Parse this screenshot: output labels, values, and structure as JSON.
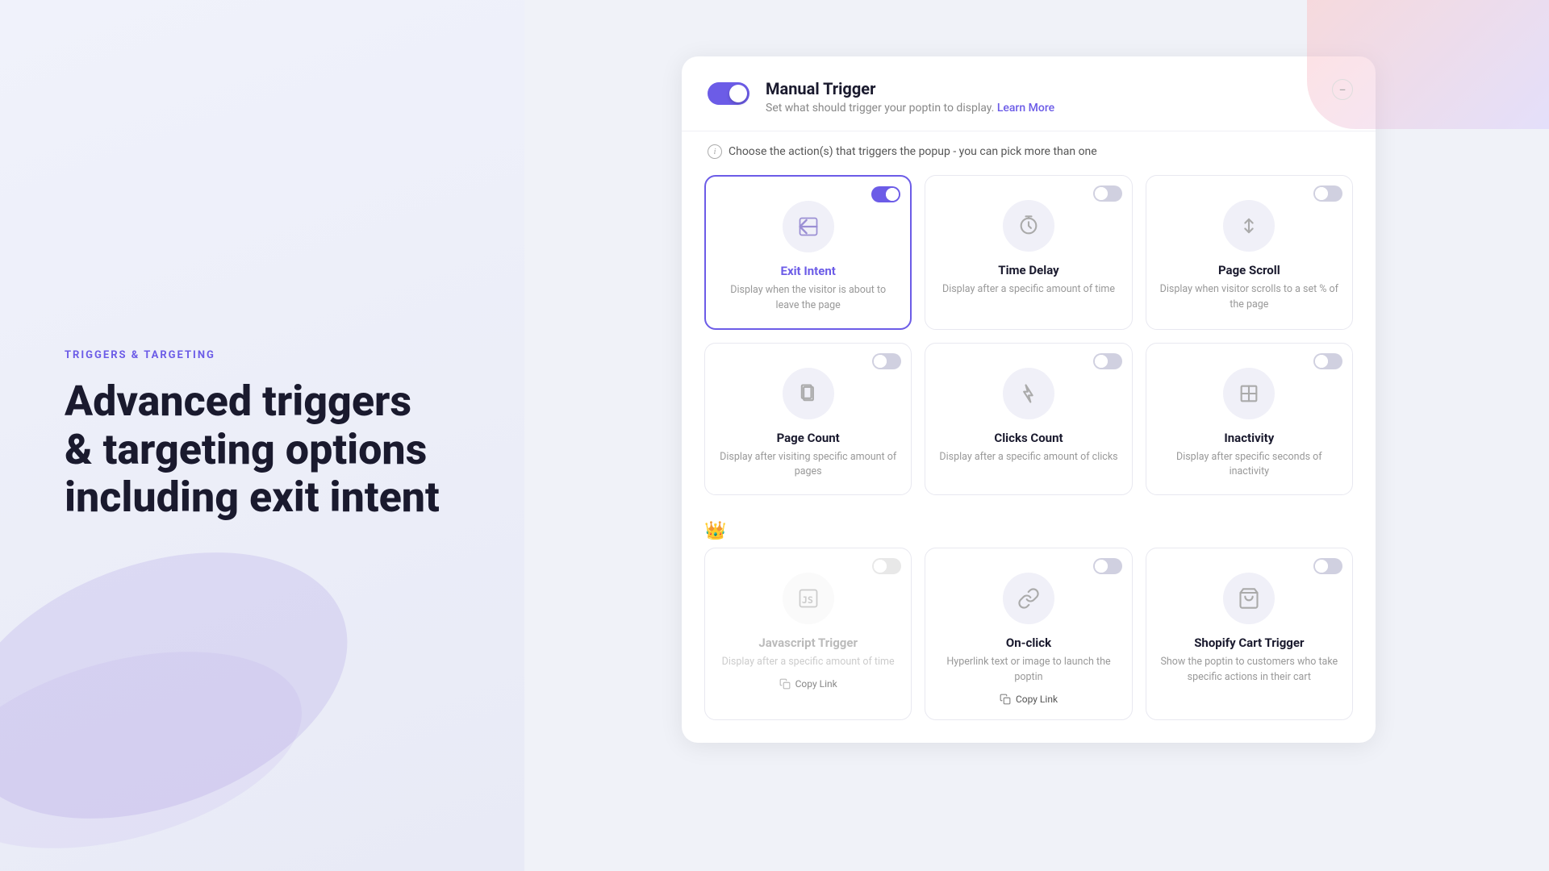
{
  "left": {
    "section_label": "TRIGGERS & TARGETING",
    "heading_line1": "Advanced triggers",
    "heading_line2": "& targeting options",
    "heading_line3": "including exit intent"
  },
  "right": {
    "header": {
      "title": "Manual Trigger",
      "subtitle": "Set what should trigger your poptin to display.",
      "learn_more": "Learn More",
      "toggle_active": true
    },
    "choose_action_text": "Choose the action(s) that triggers the popup - you can pick more than one",
    "triggers": [
      {
        "id": "exit-intent",
        "title": "Exit Intent",
        "description": "Display when the visitor is about to leave the page",
        "active": true,
        "icon": "exit"
      },
      {
        "id": "time-delay",
        "title": "Time Delay",
        "description": "Display after a specific amount of time",
        "active": false,
        "icon": "clock"
      },
      {
        "id": "page-scroll",
        "title": "Page Scroll",
        "description": "Display when visitor scrolls to a set % of the page",
        "active": false,
        "icon": "scroll"
      },
      {
        "id": "page-count",
        "title": "Page Count",
        "description": "Display after visiting specific amount of pages",
        "active": false,
        "icon": "pages"
      },
      {
        "id": "clicks-count",
        "title": "Clicks Count",
        "description": "Display after a specific amount of clicks",
        "active": false,
        "icon": "clicks"
      },
      {
        "id": "inactivity",
        "title": "Inactivity",
        "description": "Display after specific seconds of inactivity",
        "active": false,
        "icon": "timer"
      }
    ],
    "bottom_triggers": [
      {
        "id": "javascript-trigger",
        "title": "Javascript Trigger",
        "description": "Display after a specific amount of time",
        "active": false,
        "disabled": true,
        "icon": "js",
        "copy_link": "Copy Link"
      },
      {
        "id": "on-click",
        "title": "On-click",
        "description": "Hyperlink text or image to launch the poptin",
        "active": false,
        "icon": "link",
        "copy_link": "Copy Link"
      },
      {
        "id": "shopify-cart",
        "title": "Shopify Cart Trigger",
        "description": "Show the poptin to customers who take specific actions in their cart",
        "active": false,
        "icon": "shopify"
      }
    ]
  }
}
